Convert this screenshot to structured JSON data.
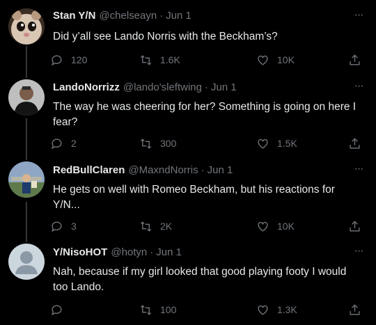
{
  "tweets": [
    {
      "name": "Stan Y/N",
      "handle": "@chelseayn",
      "sep": "·",
      "date": "Jun 1",
      "text": "Did y’all see Lando Norris with the Beckham’s?",
      "replies": "120",
      "retweets": "1.6K",
      "likes": "10K",
      "more": "···",
      "avatar_colors": [
        "#d9c7b4",
        "#8a6f57"
      ]
    },
    {
      "name": "LandoNorrizz",
      "handle": "@lando'sleftwing",
      "sep": "·",
      "date": "Jun 1",
      "text": "The way he was cheering for her? Something is going on here I fear?",
      "replies": "2",
      "retweets": "300",
      "likes": "1.5K",
      "more": "···",
      "avatar_colors": [
        "#c9c9c9",
        "#1a1a1a"
      ]
    },
    {
      "name": "RedBullClaren",
      "handle": "@MaxndNorris",
      "sep": "·",
      "date": "Jun 1",
      "text": "He gets on well with Romeo Beckham, but his reactions for Y/N...",
      "replies": "3",
      "retweets": "2K",
      "likes": "10K",
      "more": "···",
      "avatar_colors": [
        "#6a7d5a",
        "#8fa7c4"
      ]
    },
    {
      "name": "Y/NisoHOT",
      "handle": "@hotyn",
      "sep": "·",
      "date": "Jun 1",
      "text": "Nah, because if my girl looked that good playing footy I would too Lando.",
      "replies": "",
      "retweets": "100",
      "likes": "1.3K",
      "more": "···",
      "avatar_colors": [
        "#ccd6dd",
        "#8b98a5"
      ]
    }
  ],
  "icons": {
    "reply": "reply-icon",
    "retweet": "retweet-icon",
    "like": "like-icon",
    "share": "share-icon",
    "more": "more-icon"
  },
  "colors": {
    "background": "#000000",
    "text": "#e7e9ea",
    "muted": "#71767b",
    "thread_line": "#333639"
  }
}
